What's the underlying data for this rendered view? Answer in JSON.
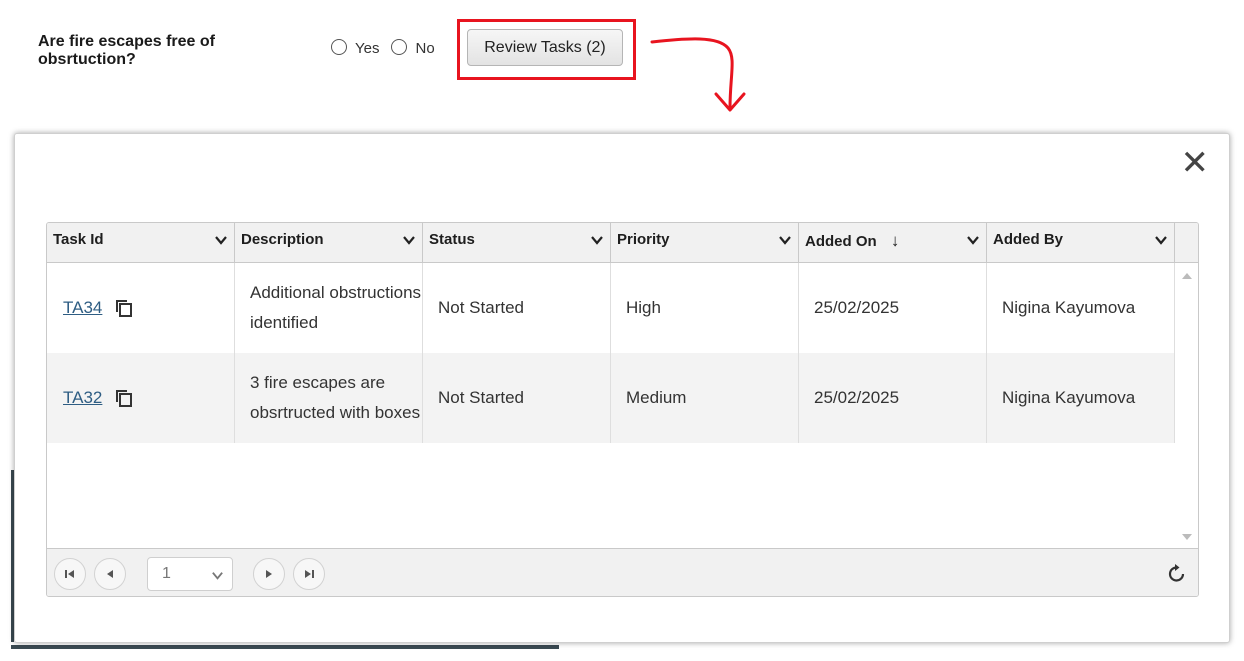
{
  "question": {
    "text": "Are fire escapes free of obsrtuction?",
    "options": [
      "Yes",
      "No"
    ],
    "review_button": "Review Tasks (2)"
  },
  "modal": {
    "close_icon": "close-icon",
    "grid": {
      "columns": [
        {
          "label": "Task Id"
        },
        {
          "label": "Description"
        },
        {
          "label": "Status"
        },
        {
          "label": "Priority"
        },
        {
          "label": "Added On",
          "sort_icon": "↓"
        },
        {
          "label": "Added By"
        }
      ],
      "rows": [
        {
          "task_id": "TA34",
          "description": "Additional obstructions identified",
          "status": "Not Started",
          "priority": "High",
          "added_on": "25/02/2025",
          "added_by": "Nigina Kayumova"
        },
        {
          "task_id": "TA32",
          "description": "3 fire escapes are obsrtructed with boxes",
          "status": "Not Started",
          "priority": "Medium",
          "added_on": "25/02/2025",
          "added_by": "Nigina Kayumova"
        }
      ]
    },
    "pager": {
      "current_page": "1"
    }
  },
  "colors": {
    "highlight": "#e8141f",
    "link": "#2e5d83",
    "header_bg": "#f1f1f1",
    "alt_row_bg": "#f3f3f3"
  }
}
